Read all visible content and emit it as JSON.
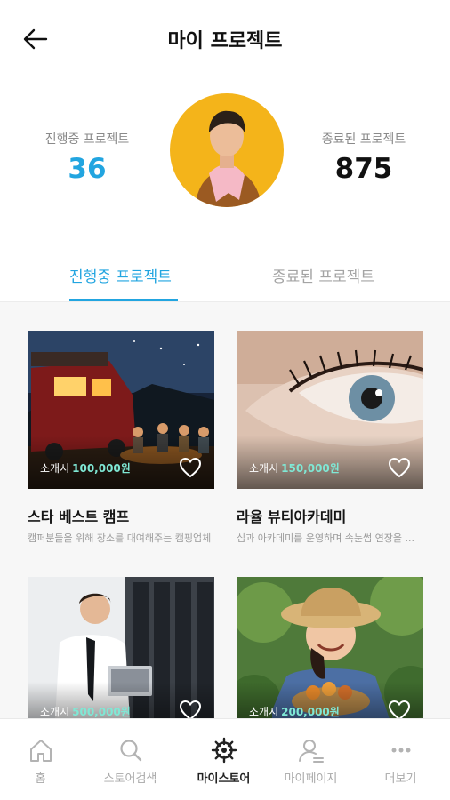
{
  "header": {
    "title": "마이 프로젝트",
    "back_icon": "arrow-left-icon"
  },
  "stats": {
    "active": {
      "label": "진행중 프로젝트",
      "value": "36"
    },
    "finished": {
      "label": "종료된 프로젝트",
      "value": "875"
    }
  },
  "tabs": [
    {
      "label": "진행중 프로젝트",
      "active": true
    },
    {
      "label": "종료된 프로젝트",
      "active": false
    }
  ],
  "cards": [
    {
      "title": "스타 베스트 캠프",
      "description": "캠퍼분들을 위해 장소를 대여해주는 캠핑업체",
      "price_prefix": "소개시",
      "price": "100,000원"
    },
    {
      "title": "라율 뷰티아카데미",
      "description": "십과 아카데미를 운영하며 속눈썹 연장을 ...",
      "price_prefix": "소개시",
      "price": "150,000원"
    },
    {
      "title": "",
      "description": "",
      "price_prefix": "소개시",
      "price": "500,000원"
    },
    {
      "title": "",
      "description": "",
      "price_prefix": "소개시",
      "price": "200,000원"
    }
  ],
  "bottom_nav": [
    {
      "label": "홈",
      "icon": "home-icon",
      "active": false
    },
    {
      "label": "스토어검색",
      "icon": "search-icon",
      "active": false
    },
    {
      "label": "마이스토어",
      "icon": "ship-wheel-icon",
      "active": true
    },
    {
      "label": "마이페이지",
      "icon": "user-icon",
      "active": false
    },
    {
      "label": "더보기",
      "icon": "more-icon",
      "active": false
    }
  ],
  "colors": {
    "accent": "#22a5e0",
    "price": "#7fe8d5",
    "avatar_bg": "#f4b41a"
  }
}
